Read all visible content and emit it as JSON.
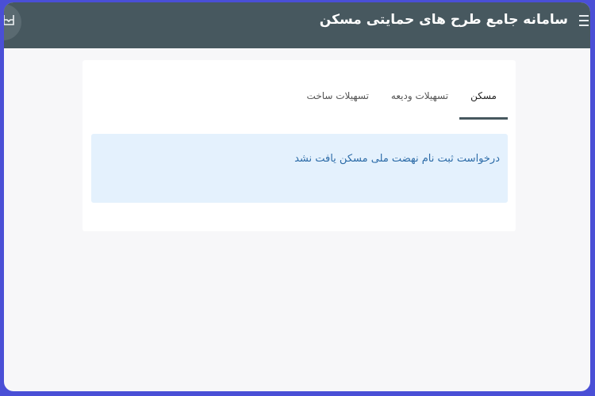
{
  "header": {
    "title": "سامانه جامع طرح های حمایتی مسکن"
  },
  "tabs": [
    {
      "label": "مسکن",
      "active": true
    },
    {
      "label": "تسهیلات ودیعه",
      "active": false
    },
    {
      "label": "تسهیلات ساخت",
      "active": false
    }
  ],
  "alert": {
    "message": "درخواست ثبت نام نهضت ملی مسکن یافت نشد"
  },
  "icons": {
    "menu": "hamburger-menu-icon",
    "user": "user-icon"
  },
  "colors": {
    "header_bg": "#47585f",
    "page_bg": "#f7f7f9",
    "alert_bg": "#e4f1fd",
    "alert_text": "#2d6ca8",
    "outer_frame": "#4a4fd6"
  }
}
